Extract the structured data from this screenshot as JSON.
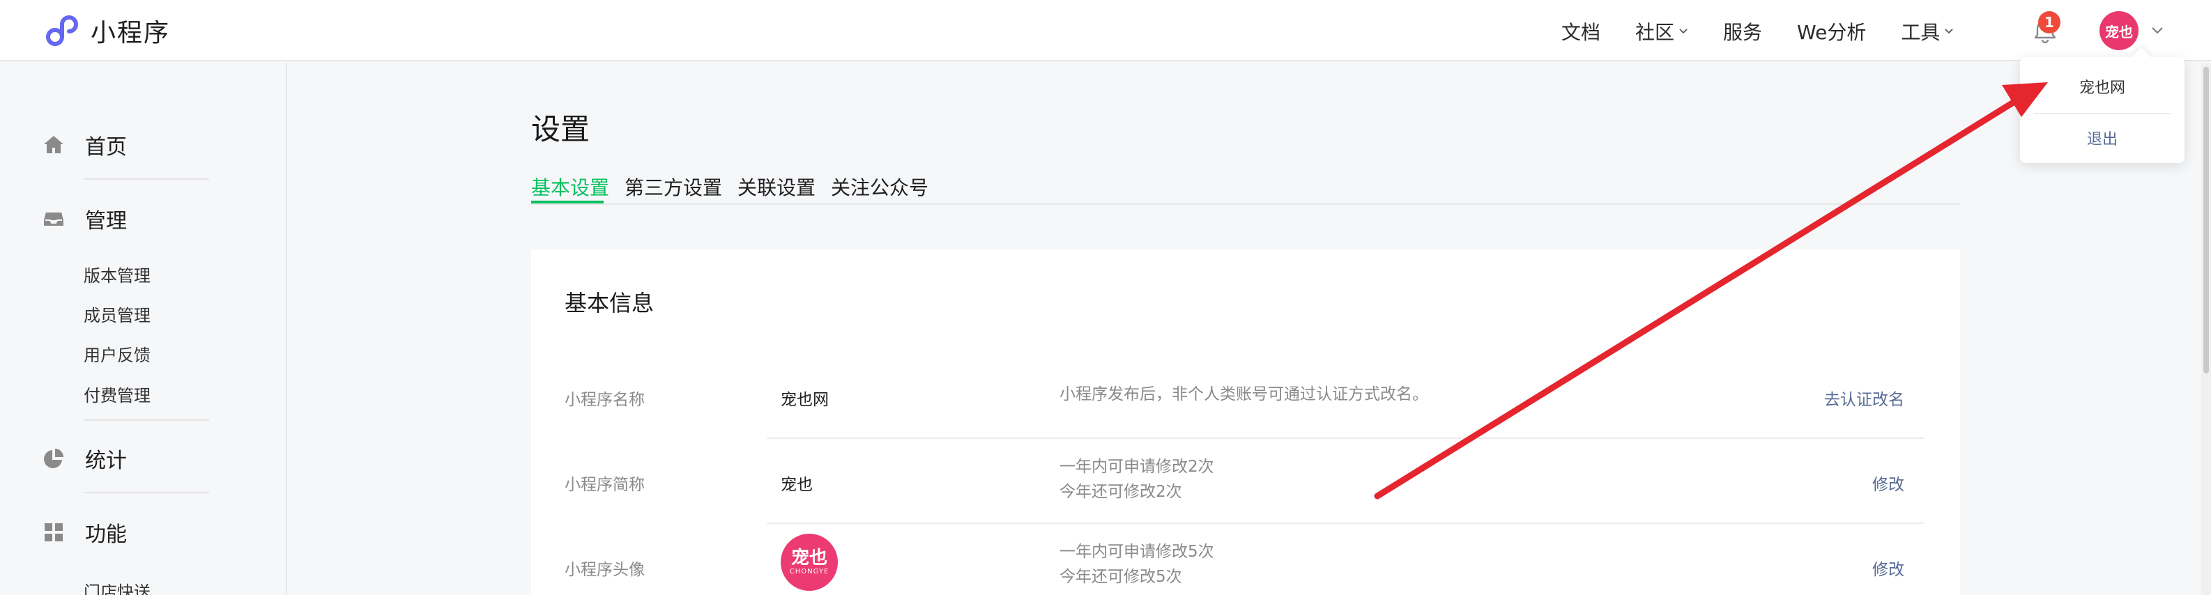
{
  "app": {
    "brand": "小程序"
  },
  "topnav": {
    "items": [
      {
        "label": "文档",
        "has_caret": false
      },
      {
        "label": "社区",
        "has_caret": true
      },
      {
        "label": "服务",
        "has_caret": false
      },
      {
        "label": "We分析",
        "has_caret": false
      },
      {
        "label": "工具",
        "has_caret": true
      }
    ],
    "notification_count": "1",
    "avatar_text": "宠也"
  },
  "account_menu": {
    "name": "宠也网",
    "logout": "退出"
  },
  "sidebar": {
    "groups": [
      {
        "label": "首页",
        "icon": "home-icon"
      },
      {
        "label": "管理",
        "icon": "inbox-icon"
      },
      {
        "label": "统计",
        "icon": "pie-chart-icon"
      },
      {
        "label": "功能",
        "icon": "grid-icon"
      }
    ],
    "manage_items": [
      "版本管理",
      "成员管理",
      "用户反馈",
      "付费管理"
    ],
    "feature_items": [
      "门店快送"
    ]
  },
  "main": {
    "title": "设置",
    "tabs": [
      "基本设置",
      "第三方设置",
      "关联设置",
      "关注公众号"
    ],
    "active_tab": "基本设置",
    "section_title": "基本信息",
    "rows": [
      {
        "label": "小程序名称",
        "value": "宠也网",
        "desc_1": "小程序发布后，非个人类账号可通过认证方式改名。",
        "desc_2": "",
        "action": "去认证改名"
      },
      {
        "label": "小程序简称",
        "value": "宠也",
        "desc_1": "一年内可申请修改2次",
        "desc_2": "今年还可修改2次",
        "action": "修改"
      },
      {
        "label": "小程序头像",
        "value": "",
        "avatar_text": "宠也",
        "avatar_subtext": "CHONGYE",
        "desc_1": "一年内可申请修改5次",
        "desc_2": "今年还可修改5次",
        "action": "修改"
      }
    ]
  },
  "colors": {
    "accent_green": "#07c160",
    "link_blue": "#576b95",
    "badge_red": "#f04a3a",
    "arrow_red": "#e5262f",
    "avatar_pink": "#ec3a73"
  }
}
